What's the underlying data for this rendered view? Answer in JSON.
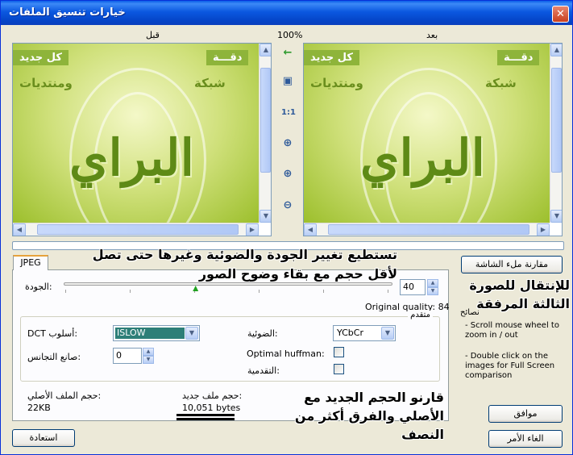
{
  "window": {
    "title": "خيارات تنسيق الملفات"
  },
  "preview": {
    "before_label": "قبل",
    "after_label": "بعد",
    "zoom": "100%",
    "image_texts": {
      "tag_left": "كل جديد",
      "tag_right": "دقـــة",
      "word_left": "ومنتديات",
      "word_right": "شبكة",
      "calligraphy": "البراي"
    }
  },
  "tools": {
    "one_to_one": "1:1"
  },
  "tabs": {
    "jpeg": "JPEG"
  },
  "quality": {
    "label": "الجودة:",
    "value": "40",
    "original": "Original quality: 84",
    "position": 0.4
  },
  "advanced": {
    "group_label": "متقدم",
    "dct_label": "DCT أسلوب:",
    "dct_value": "ISLOW",
    "smoothing_label": "صانع التجانس:",
    "smoothing_value": "0",
    "subsampling_label": "الضوئية:",
    "subsampling_value": "YCbCr",
    "optimal_label": "Optimal huffman:",
    "progressive_label": "التقدمية:"
  },
  "sizes": {
    "original_label": "حجم الملف الأصلي:",
    "original_value": "22KB",
    "new_label": "حجم ملف جديد:",
    "new_value": "10,051 bytes"
  },
  "side": {
    "compare_button": "مقارنة ملء الشاشة",
    "tips_label": "نصائح",
    "tip1": "- Scroll mouse wheel to zoom in / out",
    "tip2": "- Double click on the images for Full Screen comparison"
  },
  "buttons": {
    "ok": "موافق",
    "cancel": "الغاء الأمر",
    "restore": "استعادة"
  },
  "annotations": {
    "line1": "تستطيع تغيير الجودة والضوئية وغيرها حتى تصل",
    "line2": "لأقل حجم مع بقاء وضوح الصور",
    "line3": "للإنتقال للصورة",
    "line4": "الثالثة المرفقة",
    "line5": "قارنو الحجم الجديد مع",
    "line6": "الأصلي والفرق أكثر من",
    "line7": "النصف"
  }
}
